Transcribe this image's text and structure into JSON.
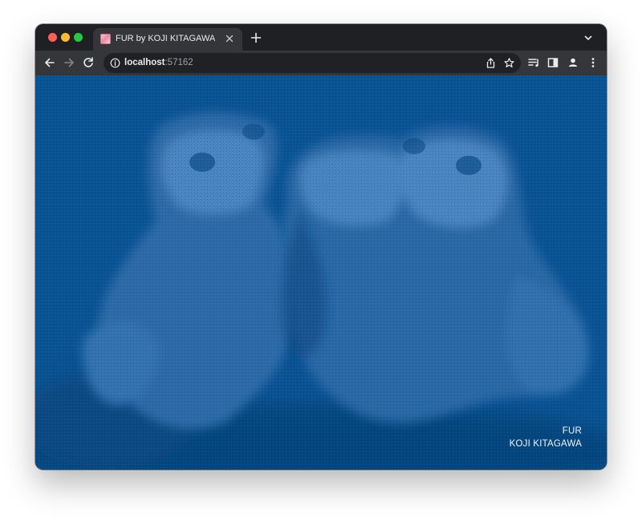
{
  "browser": {
    "tab": {
      "title": "FUR by KOJI KITAGAWA",
      "favicon": "pink-fur-favicon-icon"
    },
    "url": {
      "host": "localhost",
      "port": ":57162"
    },
    "icons": {
      "close": "close-icon",
      "new_tab": "plus-icon",
      "tab_menu": "chevron-down-icon",
      "back": "arrow-left-icon",
      "forward": "arrow-right-icon",
      "reload": "reload-icon",
      "site_info": "info-icon",
      "share": "share-icon",
      "bookmark": "star-icon",
      "reading_list": "reading-list-icon",
      "side_panel": "side-panel-icon",
      "profile": "profile-icon",
      "menu": "kebab-menu-icon"
    },
    "colors": {
      "chrome_dark": "#1f2023",
      "toolbar": "#35363a",
      "omnibox": "#202124"
    }
  },
  "page": {
    "background_color": "#0a5393",
    "image_subject": "two polar bear cubs duotone",
    "credit": {
      "title": "FUR",
      "author": "KOJI KITAGAWA"
    }
  }
}
